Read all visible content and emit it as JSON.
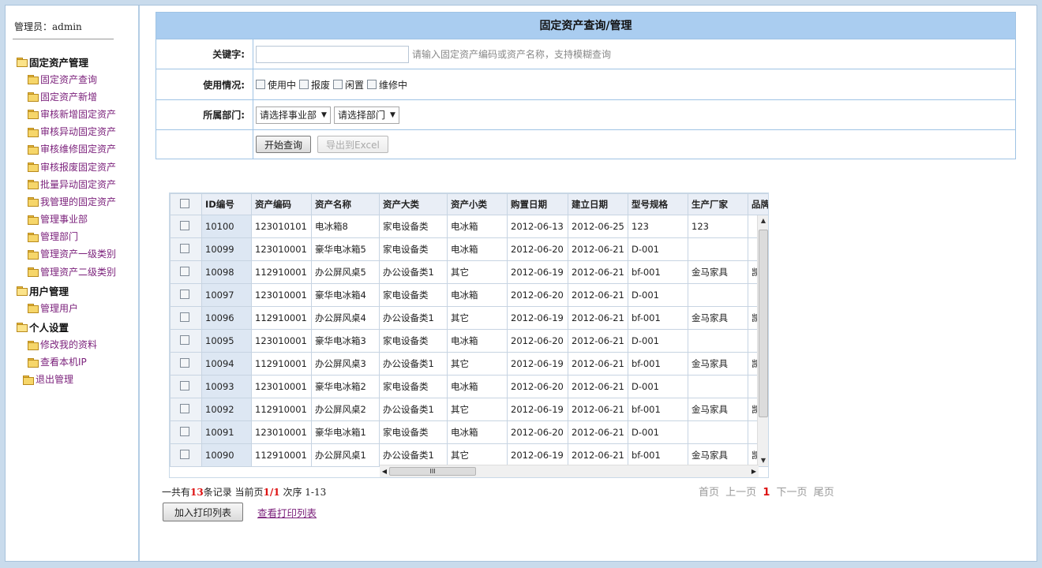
{
  "sidebar": {
    "admin_label": "管理员：admin",
    "groups": [
      {
        "title": "固定资产管理",
        "items": [
          "固定资产查询",
          "固定资产新增",
          "审核新增固定资产",
          "审核异动固定资产",
          "审核维修固定资产",
          "审核报废固定资产",
          "批量异动固定资产",
          "我管理的固定资产",
          "管理事业部",
          "管理部门",
          "管理资产一级类别",
          "管理资产二级类别"
        ]
      },
      {
        "title": "用户管理",
        "items": [
          "管理用户"
        ]
      },
      {
        "title": "个人设置",
        "items": [
          "修改我的资料",
          "查看本机IP"
        ]
      }
    ],
    "quit": "退出管理"
  },
  "query": {
    "title": "固定资产查询/管理",
    "keyword_label": "关键字:",
    "keyword_value": "",
    "keyword_hint": "请输入固定资产编码或资产名称，支持模糊查询",
    "usage_label": "使用情况:",
    "usage_options": [
      "使用中",
      "报废",
      "闲置",
      "维修中"
    ],
    "dept_label": "所属部门:",
    "division_select": "请选择事业部",
    "dept_select": "请选择部门",
    "search_button": "开始查询",
    "export_button": "导出到Excel"
  },
  "grid": {
    "columns": [
      "ID编号",
      "资产编码",
      "资产名称",
      "资产大类",
      "资产小类",
      "购置日期",
      "建立日期",
      "型号规格",
      "生产厂家",
      "品牌"
    ],
    "rows": [
      [
        "10100",
        "123010101",
        "电冰箱8",
        "家电设备类",
        "电冰箱",
        "2012-06-13",
        "2012-06-25",
        "123",
        "123",
        ""
      ],
      [
        "10099",
        "123010001",
        "豪华电冰箱5",
        "家电设备类",
        "电冰箱",
        "2012-06-20",
        "2012-06-21",
        "D-001",
        "",
        ""
      ],
      [
        "10098",
        "112910001",
        "办公屏风桌5",
        "办公设备类1",
        "其它",
        "2012-06-19",
        "2012-06-21",
        "bf-001",
        "金马家具",
        "凯乐"
      ],
      [
        "10097",
        "123010001",
        "豪华电冰箱4",
        "家电设备类",
        "电冰箱",
        "2012-06-20",
        "2012-06-21",
        "D-001",
        "",
        ""
      ],
      [
        "10096",
        "112910001",
        "办公屏风桌4",
        "办公设备类1",
        "其它",
        "2012-06-19",
        "2012-06-21",
        "bf-001",
        "金马家具",
        "凯乐"
      ],
      [
        "10095",
        "123010001",
        "豪华电冰箱3",
        "家电设备类",
        "电冰箱",
        "2012-06-20",
        "2012-06-21",
        "D-001",
        "",
        ""
      ],
      [
        "10094",
        "112910001",
        "办公屏风桌3",
        "办公设备类1",
        "其它",
        "2012-06-19",
        "2012-06-21",
        "bf-001",
        "金马家具",
        "凯乐"
      ],
      [
        "10093",
        "123010001",
        "豪华电冰箱2",
        "家电设备类",
        "电冰箱",
        "2012-06-20",
        "2012-06-21",
        "D-001",
        "",
        ""
      ],
      [
        "10092",
        "112910001",
        "办公屏风桌2",
        "办公设备类1",
        "其它",
        "2012-06-19",
        "2012-06-21",
        "bf-001",
        "金马家具",
        "凯乐"
      ],
      [
        "10091",
        "123010001",
        "豪华电冰箱1",
        "家电设备类",
        "电冰箱",
        "2012-06-20",
        "2012-06-21",
        "D-001",
        "",
        ""
      ],
      [
        "10090",
        "112910001",
        "办公屏风桌1",
        "办公设备类1",
        "其它",
        "2012-06-19",
        "2012-06-21",
        "bf-001",
        "金马家具",
        "凯乐"
      ]
    ]
  },
  "summary": {
    "prefix": "一共有",
    "total": "13",
    "mid": "条记录  当前页",
    "page": "1/1",
    "suffix": " 次序  1-13"
  },
  "pager": {
    "first": "首页",
    "prev": "上一页",
    "current": "1",
    "next": "下一页",
    "last": "尾页"
  },
  "actions": {
    "add_print": "加入打印列表",
    "view_print": "查看打印列表"
  }
}
